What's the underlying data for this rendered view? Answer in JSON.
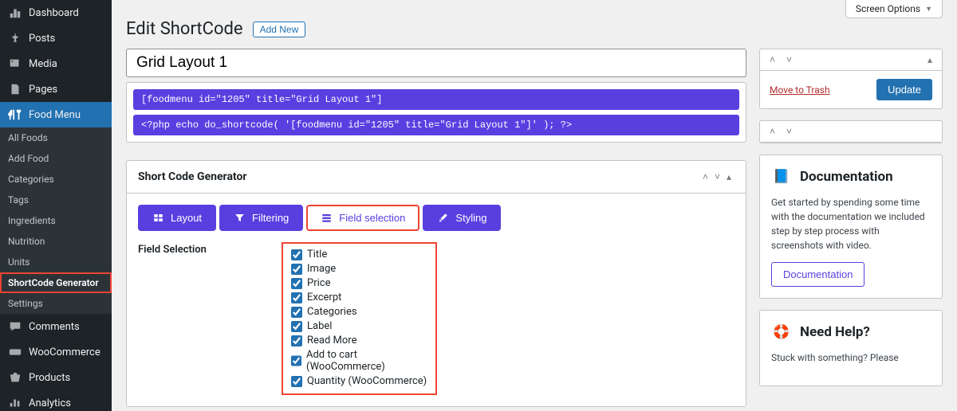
{
  "screen_options": "Screen Options",
  "sidebar": [
    {
      "label": "Dashboard",
      "icon": "dashboard"
    },
    {
      "label": "Posts",
      "icon": "pin"
    },
    {
      "label": "Media",
      "icon": "media"
    },
    {
      "label": "Pages",
      "icon": "pages"
    },
    {
      "label": "Food Menu",
      "icon": "foodmenu",
      "active": true,
      "sub": [
        {
          "label": "All Foods"
        },
        {
          "label": "Add Food"
        },
        {
          "label": "Categories"
        },
        {
          "label": "Tags"
        },
        {
          "label": "Ingredients"
        },
        {
          "label": "Nutrition"
        },
        {
          "label": "Units"
        },
        {
          "label": "ShortCode Generator",
          "highlight": true,
          "selected": true
        },
        {
          "label": "Settings"
        }
      ]
    },
    {
      "label": "Comments",
      "icon": "comments"
    },
    {
      "label": "WooCommerce",
      "icon": "woo"
    },
    {
      "label": "Products",
      "icon": "products"
    },
    {
      "label": "Analytics",
      "icon": "analytics"
    }
  ],
  "header": {
    "title": "Edit ShortCode",
    "add_new": "Add New"
  },
  "post_title": "Grid Layout 1",
  "code": {
    "line1": "[foodmenu id=\"1205\" title=\"Grid Layout 1\"]",
    "line2": "<?php echo do_shortcode( '[foodmenu id=\"1205\" title=\"Grid Layout 1\"]' ); ?>"
  },
  "generator": {
    "title": "Short Code Generator",
    "tabs": [
      {
        "label": "Layout",
        "icon": "dash"
      },
      {
        "label": "Filtering",
        "icon": "filter"
      },
      {
        "label": "Field selection",
        "icon": "list",
        "active": true,
        "highlight": true
      },
      {
        "label": "Styling",
        "icon": "brush"
      }
    ],
    "field_label": "Field Selection",
    "fields": [
      "Title",
      "Image",
      "Price",
      "Excerpt",
      "Categories",
      "Label",
      "Read More",
      "Add to cart (WooCommerce)",
      "Quantity (WooCommerce)"
    ]
  },
  "publish": {
    "trash": "Move to Trash",
    "update": "Update"
  },
  "documentation": {
    "title": "Documentation",
    "body": "Get started by spending some time with the documentation we included step by step process with screenshots with video.",
    "button": "Documentation"
  },
  "help": {
    "title": "Need Help?",
    "body": "Stuck with something? Please"
  }
}
